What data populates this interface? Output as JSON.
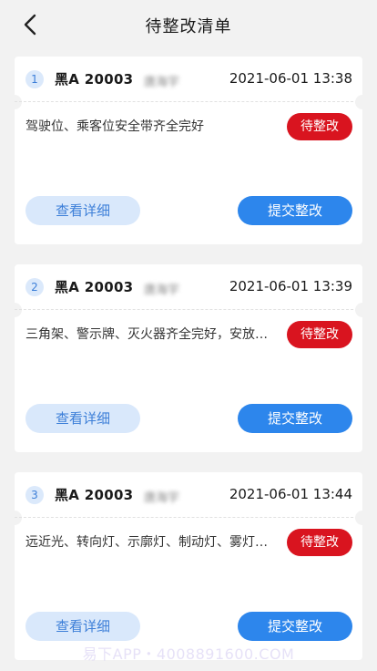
{
  "header": {
    "title": "待整改清单",
    "back_icon": "chevron-left-icon"
  },
  "cards": [
    {
      "index": "1",
      "plate": "黑A 20003",
      "driver": "唐海宇",
      "time": "2021-06-01 13:38",
      "description": "驾驶位、乘客位安全带齐全完好",
      "status": "待整改",
      "detail_label": "查看详细",
      "submit_label": "提交整改"
    },
    {
      "index": "2",
      "plate": "黑A 20003",
      "driver": "唐海宇",
      "time": "2021-06-01 13:39",
      "description": "三角架、警示牌、灭火器齐全完好，安放…",
      "status": "待整改",
      "detail_label": "查看详细",
      "submit_label": "提交整改"
    },
    {
      "index": "3",
      "plate": "黑A 20003",
      "driver": "唐海宇",
      "time": "2021-06-01 13:44",
      "description": "远近光、转向灯、示廓灯、制动灯、雾灯…",
      "status": "待整改",
      "detail_label": "查看详细",
      "submit_label": "提交整改"
    }
  ],
  "watermark": "易下APP・4008891600.COM",
  "colors": {
    "status_red": "#d9141f",
    "primary_blue": "#2d86ec",
    "light_blue": "#d9e8fb"
  }
}
